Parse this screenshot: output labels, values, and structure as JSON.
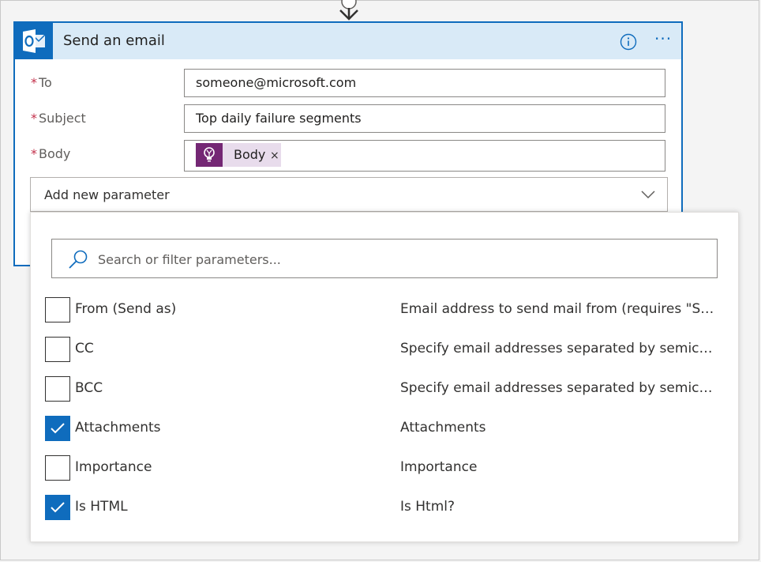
{
  "action_card": {
    "title": "Send an email",
    "fields": [
      {
        "label": "To",
        "required_mark": "*",
        "value": "someone@microsoft.com"
      },
      {
        "label": "Subject",
        "required_mark": "*",
        "value": "Top daily failure segments"
      },
      {
        "label": "Body",
        "required_mark": "*",
        "token": {
          "label": "Body",
          "remove_glyph": "×",
          "icon": "lightbulb-icon",
          "color": "#742774"
        }
      }
    ],
    "more_glyph": "···",
    "add_parameter": {
      "label": "Add new parameter"
    }
  },
  "parameter_dropdown": {
    "search_placeholder": "Search or filter parameters...",
    "items": [
      {
        "name": "From (Send as)",
        "description": "Email address to send mail from (requires \"Send as\" or \"Send on behalf of\" permission)",
        "checked": false
      },
      {
        "name": "CC",
        "description": "Specify email addresses separated by semicolons like someone@contoso.com",
        "checked": false
      },
      {
        "name": "BCC",
        "description": "Specify email addresses separated by semicolons like someone@contoso.com",
        "checked": false
      },
      {
        "name": "Attachments",
        "description": "Attachments",
        "checked": true
      },
      {
        "name": "Importance",
        "description": "Importance",
        "checked": false
      },
      {
        "name": "Is HTML",
        "description": "Is Html?",
        "checked": true
      }
    ]
  },
  "colors": {
    "accent": "#0f6cbd",
    "header_bg": "#d9eaf7",
    "required": "#c4314b",
    "token_bg": "#e8dcec",
    "token_icon_bg": "#742774"
  }
}
